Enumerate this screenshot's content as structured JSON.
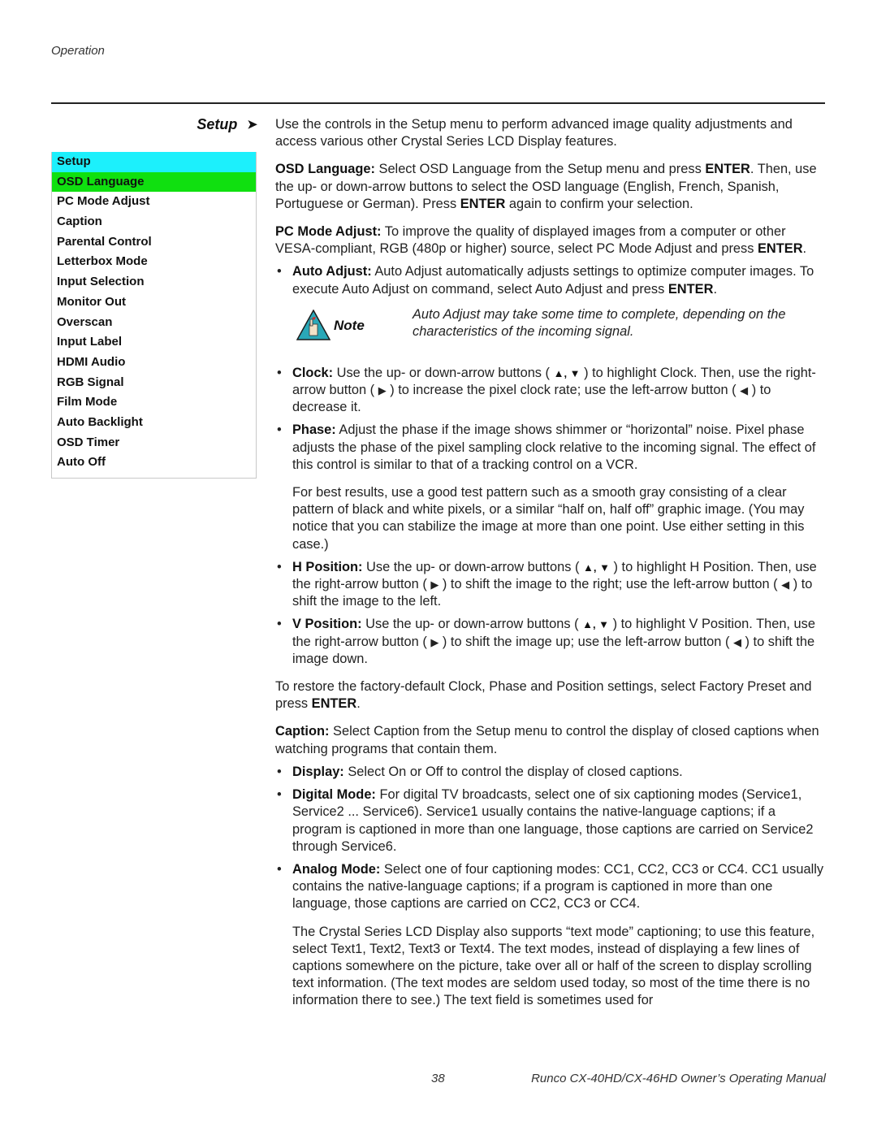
{
  "running_head": "Operation",
  "section": {
    "title": "Setup",
    "arrow": "➤"
  },
  "menu": {
    "items": [
      {
        "label": "Setup",
        "state": "header",
        "color": "#1cf0fc"
      },
      {
        "label": "OSD Language",
        "state": "selected",
        "color": "#10e010"
      },
      {
        "label": "PC Mode Adjust"
      },
      {
        "label": "Caption"
      },
      {
        "label": "Parental Control"
      },
      {
        "label": "Letterbox Mode"
      },
      {
        "label": "Input Selection"
      },
      {
        "label": "Monitor Out"
      },
      {
        "label": "Overscan"
      },
      {
        "label": "Input Label"
      },
      {
        "label": "HDMI Audio"
      },
      {
        "label": "RGB Signal"
      },
      {
        "label": "Film Mode"
      },
      {
        "label": "Auto Backlight"
      },
      {
        "label": "OSD Timer"
      },
      {
        "label": "Auto Off"
      }
    ]
  },
  "body": {
    "intro": "Use the controls in the Setup menu to perform advanced image quality adjustments and access various other Crystal Series LCD Display features.",
    "osd_language": {
      "term": "OSD Language:",
      "t1": " Select OSD Language from the Setup menu and press ",
      "enter1": "ENTER",
      "t2": ". Then, use the up- or down-arrow buttons to select the OSD language (English, French, Spanish, Portuguese or German). Press ",
      "enter2": "ENTER",
      "t3": " again to confirm your selection."
    },
    "pc_mode": {
      "term": "PC Mode Adjust:",
      "t1": " To improve the quality of displayed images from a computer or other VESA-compliant, RGB (480p or higher) source, select PC Mode Adjust and press ",
      "enter": "ENTER",
      "t2": "."
    },
    "auto_adjust": {
      "term": "Auto Adjust:",
      "t1": " Auto Adjust automatically adjusts settings to optimize computer images. To execute Auto Adjust on command, select Auto Adjust and press ",
      "enter": "ENTER",
      "t2": "."
    },
    "note": {
      "label": "Note",
      "text": "Auto Adjust may take some time to complete, depending on the characteristics of the incoming signal."
    },
    "clock": {
      "term": "Clock:",
      "t1": " Use the up- or down-arrow buttons ( ",
      "up_down": "▲, ▼",
      "t2": " ) to highlight Clock. Then, use the right-arrow button ( ",
      "right": "▶",
      "t3": " ) to increase the pixel clock rate; use the left-arrow button ( ",
      "left": "◀",
      "t4": " ) to decrease it."
    },
    "phase": {
      "term": "Phase:",
      "t1": " Adjust the phase if the image shows shimmer or “horizontal” noise. Pixel phase adjusts the phase of the pixel sampling clock relative to the incoming signal. The effect of this control is similar to that of a tracking control on a VCR.",
      "extra": "For best results, use a good test pattern such as a smooth gray consisting of a clear pattern of black and white pixels, or a similar “half on, half off” graphic image. (You may notice that you can stabilize the image at more than one point. Use either setting in this case.)"
    },
    "h_position": {
      "term": "H Position:",
      "t1": " Use the up- or down-arrow buttons ( ",
      "up_down": "▲, ▼",
      "t2": " ) to highlight H Position. Then, use the right-arrow button ( ",
      "right": "▶",
      "t3": " ) to shift the image to the right; use the left-arrow button ( ",
      "left": "◀",
      "t4": " ) to shift the image to the left."
    },
    "v_position": {
      "term": "V Position:",
      "t1": " Use the up- or down-arrow buttons ( ",
      "up_down": "▲, ▼",
      "t2": " ) to highlight V Position. Then, use the right-arrow button ( ",
      "right": "▶",
      "t3": " ) to shift the image up; use the left-arrow button ( ",
      "left": "◀",
      "t4": " ) to shift the image down."
    },
    "restore": {
      "t1": "To restore the factory-default Clock, Phase and Position settings, select Factory Preset and press ",
      "enter": "ENTER",
      "t2": "."
    },
    "caption": {
      "term": "Caption:",
      "t1": " Select Caption from the Setup menu to control the display of closed captions when watching programs that contain them."
    },
    "display": {
      "term": "Display:",
      "t1": " Select On or Off to control the display of closed captions."
    },
    "digital_mode": {
      "term": "Digital Mode:",
      "t1": " For digital TV broadcasts, select one of six captioning modes (Service1, Service2 ... Service6). Service1 usually contains the native-language captions; if a program is captioned in more than one language, those captions are carried on Service2 through Service6."
    },
    "analog_mode": {
      "term": "Analog Mode:",
      "t1": " Select one of four captioning modes: CC1, CC2, CC3 or CC4. CC1 usually contains the native-language captions; if a program is captioned in more than one language, those captions are carried on CC2, CC3 or CC4."
    },
    "text_mode": "The Crystal Series LCD Display also supports “text mode” captioning; to use this feature, select Text1, Text2, Text3 or Text4. The text modes, instead of displaying a few lines of captions somewhere on the picture, take over all or half of the screen to display scrolling text information. (The text modes are seldom used today, so most of the time there is no information there to see.) The text field is sometimes used for"
  },
  "footer": {
    "page_number": "38",
    "manual_title": "Runco CX-40HD/CX-46HD Owner’s Operating Manual"
  }
}
